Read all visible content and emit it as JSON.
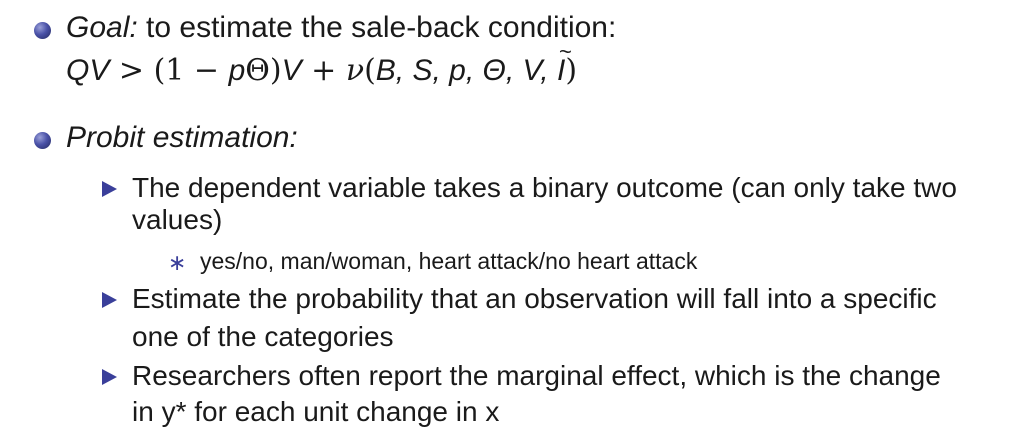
{
  "slide": {
    "goal": {
      "label": "Goal:",
      "text": " to estimate the sale-back condition:",
      "formula": {
        "q": "Q",
        "v1": "V",
        "gt": " > ",
        "open1": "(1 − ",
        "p": "p",
        "theta": "Θ",
        "close1": ")",
        "v2": "V",
        "plus": " + ",
        "nu": "ν",
        "open2": "(",
        "args": "B, S, p, Θ, V, ",
        "i": "I",
        "tilde": "~",
        "close2": ")"
      }
    },
    "probit": {
      "label": "Probit estimation:",
      "items": [
        {
          "line1": "The dependent variable takes a binary outcome (can only take two",
          "line2": "values)",
          "subitems": [
            {
              "marker": "∗",
              "text": "yes/no, man/woman, heart attack/no heart attack"
            }
          ]
        },
        {
          "line1": "Estimate the probability that an observation will fall into a specific",
          "line2": "one of the categories"
        },
        {
          "line1": "Researchers often report the marginal effect, which is the change",
          "line2": "in y* for each unit change in x"
        }
      ]
    }
  }
}
